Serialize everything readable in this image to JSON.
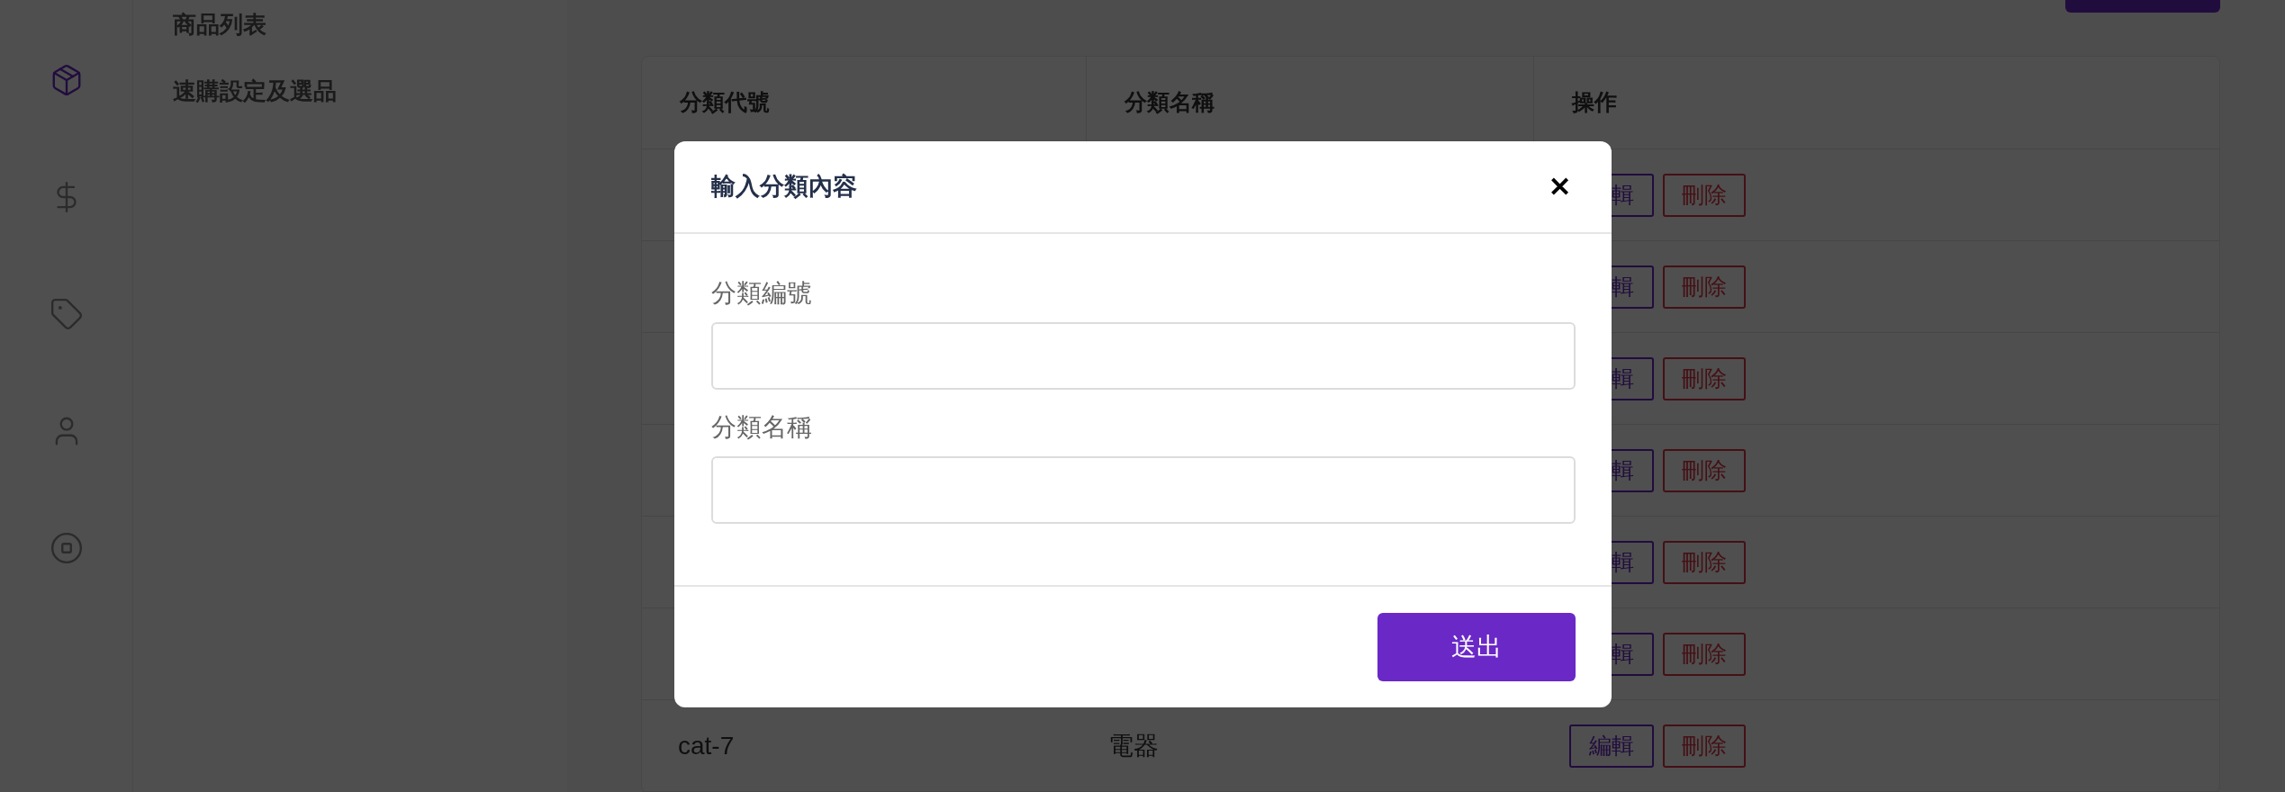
{
  "nav_rail": [
    {
      "kind": "package",
      "selected": true
    },
    {
      "kind": "dollar",
      "selected": false
    },
    {
      "kind": "tag",
      "selected": false
    },
    {
      "kind": "user",
      "selected": false
    },
    {
      "kind": "stop",
      "selected": false
    }
  ],
  "subnav": {
    "items": [
      {
        "label": "商品列表"
      },
      {
        "label": "速購設定及選品"
      }
    ]
  },
  "table": {
    "columns": [
      "分類代號",
      "分類名稱",
      "操作"
    ],
    "rows": [
      {
        "edit": "輯",
        "delete": "刪除"
      },
      {
        "edit": "輯",
        "delete": "刪除"
      },
      {
        "edit": "輯",
        "delete": "刪除"
      },
      {
        "edit": "輯",
        "delete": "刪除"
      },
      {
        "edit": "輯",
        "delete": "刪除"
      },
      {
        "edit": "輯",
        "delete": "刪除"
      },
      {
        "code": "cat-7",
        "name": "電器",
        "edit": "編輯",
        "delete": "刪除"
      }
    ]
  },
  "modal": {
    "title": "輸入分類內容",
    "close": "✕",
    "fields": [
      {
        "label": "分類編號"
      },
      {
        "label": "分類名稱"
      }
    ],
    "submit": "送出"
  }
}
